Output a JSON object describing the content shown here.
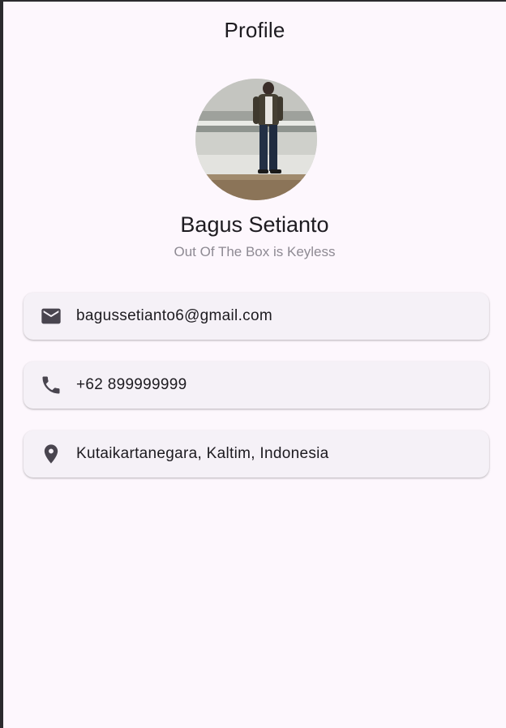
{
  "app_bar": {
    "title": "Profile"
  },
  "profile": {
    "avatar_icon": "profile-photo",
    "name": "Bagus Setianto",
    "subtitle": "Out Of The Box is Keyless"
  },
  "contacts": [
    {
      "icon": "email-icon",
      "value": "bagussetianto6@gmail.com"
    },
    {
      "icon": "phone-icon",
      "value": "+62 899999999"
    },
    {
      "icon": "location-pin-icon",
      "value": "Kutaikartanegara, Kaltim, Indonesia"
    }
  ],
  "colors": {
    "background": "#fdf7fd",
    "card": "#f5f1f7",
    "icon": "#49454f",
    "text": "#1d1b20",
    "subtitle": "#8e8a93"
  }
}
